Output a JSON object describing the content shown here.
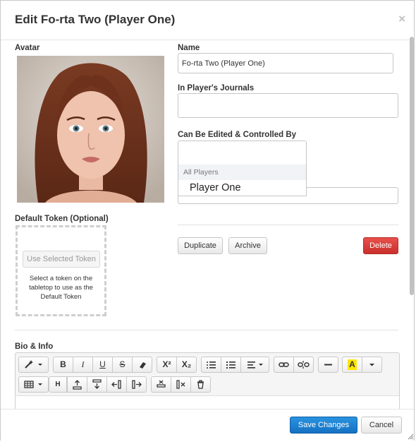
{
  "dialog": {
    "title": "Edit Fo-rta Two (Player One)",
    "close": "×"
  },
  "avatar": {
    "label": "Avatar"
  },
  "name": {
    "label": "Name",
    "value": "Fo-rta Two (Player One)"
  },
  "journals": {
    "label": "In Player's Journals",
    "value": ""
  },
  "control": {
    "label": "Can Be Edited & Controlled By",
    "options": [
      "All Players",
      "Player One"
    ]
  },
  "token": {
    "label": "Default Token (Optional)",
    "button": "Use Selected Token",
    "help": "Select a token on the tabletop to use as the Default Token"
  },
  "actions": {
    "duplicate": "Duplicate",
    "archive": "Archive",
    "delete": "Delete"
  },
  "bio": {
    "label": "Bio & Info"
  },
  "toolbar": {
    "row1": [
      "magic-wand",
      "B",
      "I",
      "U",
      "S",
      "eraser",
      "X²",
      "X₂",
      "ol",
      "ul",
      "align",
      "link",
      "unlink",
      "hr",
      "A",
      "color-menu"
    ],
    "row2": [
      "table",
      "H",
      "row-above",
      "row-below",
      "col-left",
      "col-right",
      "del-row",
      "del-col",
      "trash"
    ]
  },
  "footer": {
    "save": "Save Changes",
    "cancel": "Cancel"
  },
  "colors": {
    "save": "#1a7fd4",
    "delete": "#d9534f",
    "highlight": "#ffe600"
  }
}
